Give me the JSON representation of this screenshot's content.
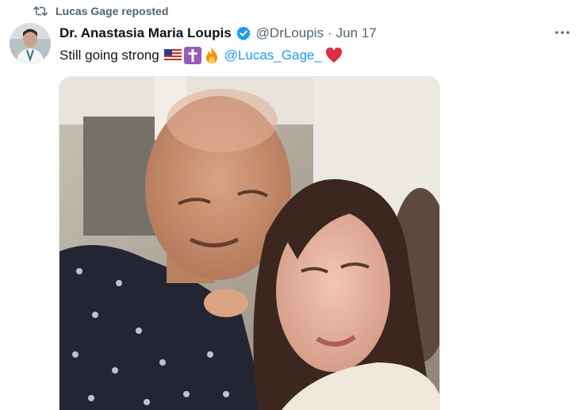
{
  "repost": {
    "label": "Lucas Gage reposted",
    "icon": "repost-icon"
  },
  "tweet": {
    "author_name": "Dr. Anastasia Maria Loupis",
    "handle": "@DrLoupis",
    "separator": "·",
    "date": "Jun 17",
    "text": "Still going strong",
    "mention": "@Lucas_Gage_",
    "emojis": [
      "us-flag-emoji",
      "latin-cross-emoji",
      "fire-emoji",
      "red-heart-emoji"
    ],
    "verified_icon": "verified-badge-icon",
    "more_icon": "more-options-icon"
  },
  "colors": {
    "text_primary": "#0f1419",
    "text_secondary": "#536471",
    "link": "#1d9bf0",
    "verified": "#1d9bf0",
    "heart": "#e0245e"
  }
}
